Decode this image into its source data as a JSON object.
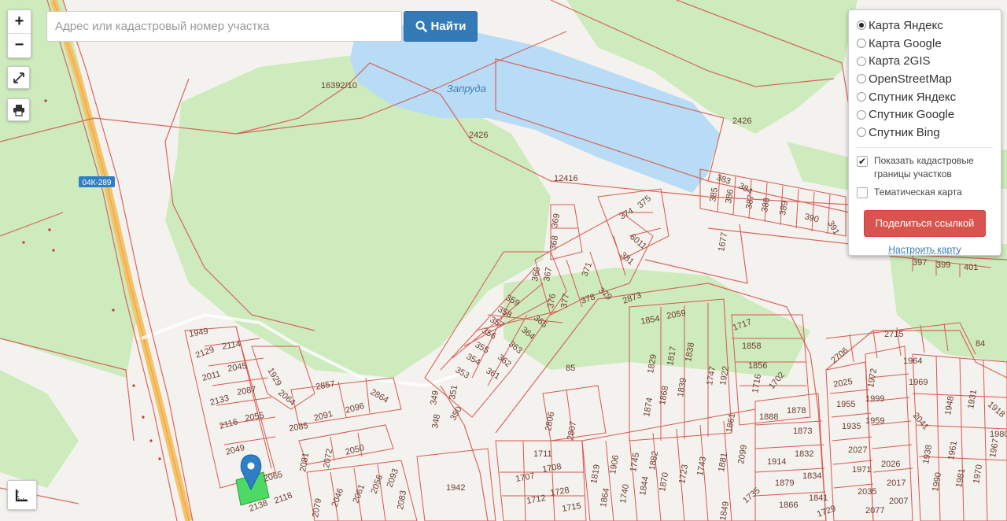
{
  "search": {
    "placeholder": "Адрес или кадастровый номер участка",
    "button_label": "Найти"
  },
  "zoom": {
    "in_label": "+",
    "out_label": "−"
  },
  "layers": [
    {
      "label": "Карта Яндекс",
      "selected": true
    },
    {
      "label": "Карта Google",
      "selected": false
    },
    {
      "label": "Карта 2GIS",
      "selected": false
    },
    {
      "label": "OpenStreetMap",
      "selected": false
    },
    {
      "label": "Спутник Яндекс",
      "selected": false
    },
    {
      "label": "Спутник Google",
      "selected": false
    },
    {
      "label": "Спутник Bing",
      "selected": false
    }
  ],
  "options": {
    "cadastral": {
      "label": "Показать кадастровые границы участков",
      "checked": true
    },
    "thematic": {
      "label": "Тематическая карта",
      "checked": false
    }
  },
  "share_label": "Поделиться ссылкой",
  "settings_label": "Настроить карту",
  "map": {
    "lake_label": "Запруда",
    "road_label": "04К-289",
    "parcels": [
      "16392/10",
      "2426",
      "2426",
      "12416",
      "1677",
      "1677",
      "1949",
      "2129",
      "2114",
      "2011",
      "2045",
      "2133",
      "2087",
      "2116",
      "2055",
      "2049",
      "2065",
      "2138",
      "2118",
      "2857",
      "2864",
      "2091",
      "2096",
      "2085",
      "2081",
      "2072",
      "2050",
      "2046",
      "2061",
      "2056",
      "2093",
      "2079",
      "2083",
      "1942",
      "1929",
      "2064",
      "383",
      "384",
      "385",
      "386",
      "387",
      "388",
      "389",
      "390",
      "391",
      "397",
      "399",
      "401",
      "374",
      "375",
      "6011",
      "381",
      "369",
      "368",
      "366",
      "367",
      "371",
      "379",
      "376",
      "377",
      "378",
      "359",
      "358",
      "357",
      "356",
      "355",
      "354",
      "353",
      "365",
      "364",
      "363",
      "362",
      "361",
      "349",
      "351",
      "348",
      "350",
      "85",
      "2873",
      "1854",
      "2059",
      "1717",
      "1858",
      "1856",
      "1829",
      "1817",
      "1838",
      "1747",
      "1922",
      "1868",
      "1839",
      "1874",
      "1716",
      "1702",
      "1888",
      "1878",
      "1873",
      "2806",
      "2807",
      "1861",
      "2099",
      "1711",
      "1707",
      "1708",
      "1712",
      "1728",
      "1715",
      "1819",
      "1906",
      "1745",
      "1882",
      "1723",
      "1743",
      "1881",
      "1864",
      "1740",
      "1844",
      "1870",
      "1914",
      "1832",
      "1879",
      "1834",
      "1866",
      "1841",
      "1849",
      "1735",
      "1729",
      "2715",
      "84",
      "2706",
      "2025",
      "1972",
      "1964",
      "1969",
      "1955",
      "1999",
      "1935",
      "1959",
      "2041",
      "1948",
      "1931",
      "1918",
      "1980",
      "2027",
      "1971",
      "2026",
      "1938",
      "1961",
      "1967",
      "2035",
      "2017",
      "1990",
      "1981",
      "1970",
      "2077",
      "2007"
    ]
  },
  "colors": {
    "parcel_border": "#d8574f",
    "forest": "#cdebbd",
    "water": "#b8dcf5",
    "road": "#f5c26a",
    "accent": "#337ab7",
    "share": "#d9534f",
    "selected_parcel": "#4cd964"
  },
  "icons": {
    "search": "search-icon",
    "fullscreen": "expand-icon",
    "print": "printer-icon",
    "ruler": "ruler-icon",
    "marker": "map-marker-icon"
  }
}
